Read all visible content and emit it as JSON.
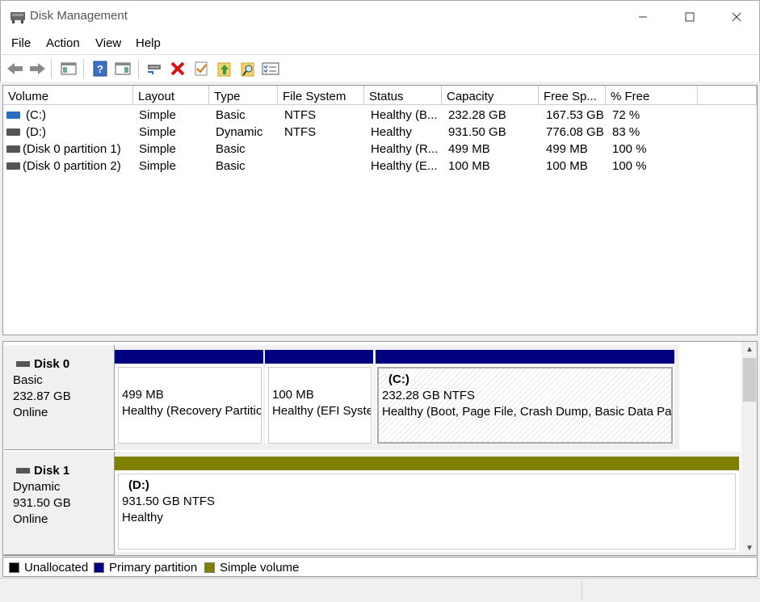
{
  "window": {
    "title": "Disk Management"
  },
  "menu": [
    "File",
    "Action",
    "View",
    "Help"
  ],
  "toolbar": [
    "back-icon",
    "forward-icon",
    "console-tree-icon",
    "help-icon",
    "properties-icon",
    "connect-disk-icon",
    "delete-icon",
    "check-icon",
    "folder-up-icon",
    "search-folder-icon",
    "list-icon"
  ],
  "volume_table": {
    "columns": [
      "Volume",
      "Layout",
      "Type",
      "File System",
      "Status",
      "Capacity",
      "Free Sp...",
      "% Free"
    ],
    "rows": [
      {
        "volume": "(C:)",
        "layout": "Simple",
        "type": "Basic",
        "fs": "NTFS",
        "status": "Healthy (B...",
        "capacity": "232.28 GB",
        "free": "167.53 GB",
        "pct": "72 %"
      },
      {
        "volume": "(D:)",
        "layout": "Simple",
        "type": "Dynamic",
        "fs": "NTFS",
        "status": "Healthy",
        "capacity": "931.50 GB",
        "free": "776.08 GB",
        "pct": "83 %"
      },
      {
        "volume": "(Disk 0 partition 1)",
        "layout": "Simple",
        "type": "Basic",
        "fs": "",
        "status": "Healthy (R...",
        "capacity": "499 MB",
        "free": "499 MB",
        "pct": "100 %"
      },
      {
        "volume": "(Disk 0 partition 2)",
        "layout": "Simple",
        "type": "Basic",
        "fs": "",
        "status": "Healthy (E...",
        "capacity": "100 MB",
        "free": "100 MB",
        "pct": "100 %"
      }
    ]
  },
  "disks": [
    {
      "name": "Disk 0",
      "type": "Basic",
      "size": "232.87 GB",
      "state": "Online",
      "partitions": [
        {
          "label": "",
          "size": "499 MB",
          "status": "Healthy (Recovery Partition)"
        },
        {
          "label": "",
          "size": "100 MB",
          "status": "Healthy (EFI System Partition)"
        },
        {
          "label": "(C:)",
          "size": "232.28 GB NTFS",
          "status": "Healthy (Boot, Page File, Crash Dump, Basic Data Partition)"
        }
      ]
    },
    {
      "name": "Disk 1",
      "type": "Dynamic",
      "size": "931.50 GB",
      "state": "Online",
      "partitions": [
        {
          "label": "(D:)",
          "size": "931.50 GB NTFS",
          "status": "Healthy"
        }
      ]
    }
  ],
  "legend": [
    {
      "label": "Unallocated",
      "color": "#000000"
    },
    {
      "label": "Primary partition",
      "color": "#000080"
    },
    {
      "label": "Simple volume",
      "color": "#808000"
    }
  ],
  "colors": {
    "primary": "#000080",
    "simple": "#808000"
  }
}
